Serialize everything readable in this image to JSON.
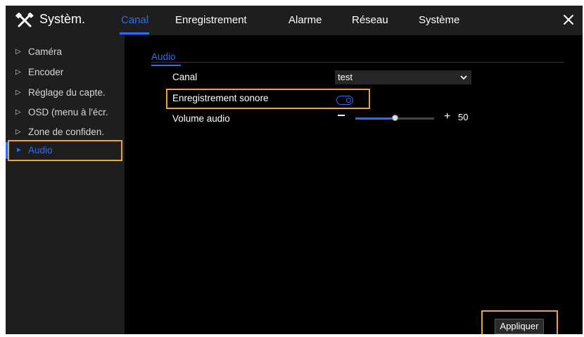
{
  "header": {
    "brand": "Systèm.",
    "tabs": [
      {
        "label": "Canal"
      },
      {
        "label": "Enregistrement"
      },
      {
        "label": "Alarme"
      },
      {
        "label": "Réseau"
      },
      {
        "label": "Système"
      }
    ],
    "active_tab": "Canal"
  },
  "sidebar": {
    "items": [
      {
        "label": "Caméra"
      },
      {
        "label": "Encoder"
      },
      {
        "label": "Réglage du capte."
      },
      {
        "label": "OSD (menu à l'écr."
      },
      {
        "label": "Zone de confiden."
      },
      {
        "label": "Audio"
      }
    ],
    "active_item": "Audio"
  },
  "main": {
    "section_title": "Audio",
    "channel": {
      "label": "Canal",
      "value": "test"
    },
    "audio_recording": {
      "label": "Enregistrement sonore",
      "enabled": true
    },
    "volume": {
      "label": "Volume audio",
      "value": "50",
      "level_fraction": 0.5
    },
    "apply_label": "Appliquer"
  },
  "colors": {
    "accent": "#2c6ef2",
    "highlight": "#f0a23a",
    "panel": "#1e1e1e",
    "background": "#000000"
  }
}
